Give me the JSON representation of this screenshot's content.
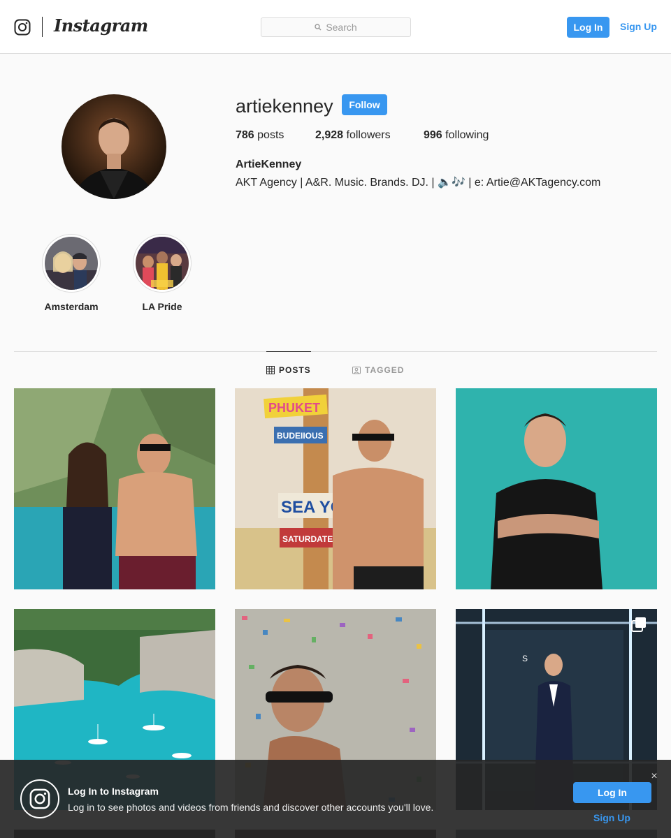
{
  "header": {
    "logo_icon": "instagram-glyph-icon",
    "wordmark": "Instagram",
    "search_placeholder": "Search",
    "login_label": "Log In",
    "signup_label": "Sign Up"
  },
  "profile": {
    "username": "artiekenney",
    "follow_label": "Follow",
    "stats": {
      "posts_count": "786",
      "posts_label": "posts",
      "followers_count": "2,928",
      "followers_label": "followers",
      "following_count": "996",
      "following_label": "following"
    },
    "full_name": "ArtieKenney",
    "bio": "AKT Agency | A&R. Music. Brands. DJ. | 🔈🎶 | e: Artie@AKTagency.com"
  },
  "highlights": [
    {
      "label": "Amsterdam"
    },
    {
      "label": "LA Pride"
    }
  ],
  "tabs": {
    "posts_label": "POSTS",
    "tagged_label": "TAGGED"
  },
  "posts": [
    {
      "overlay_texts": []
    },
    {
      "overlay_texts": [
        "PHUKET",
        "BUDEIIOUS",
        "SEA YOU",
        "SATURDATE"
      ]
    },
    {
      "overlay_texts": []
    },
    {
      "overlay_texts": []
    },
    {
      "overlay_texts": []
    },
    {
      "overlay_texts": [
        "S"
      ],
      "multi_icon": "multiple-photos-icon"
    }
  ],
  "banner": {
    "title": "Log In to Instagram",
    "subtitle": "Log in to see photos and videos from friends and discover other accounts you'll love.",
    "close": "×",
    "login_label": "Log In",
    "signup_label": "Sign Up"
  },
  "colors": {
    "accent": "#3897f0",
    "background": "#fafafa",
    "text": "#262626",
    "banner_bg": "#262626"
  }
}
